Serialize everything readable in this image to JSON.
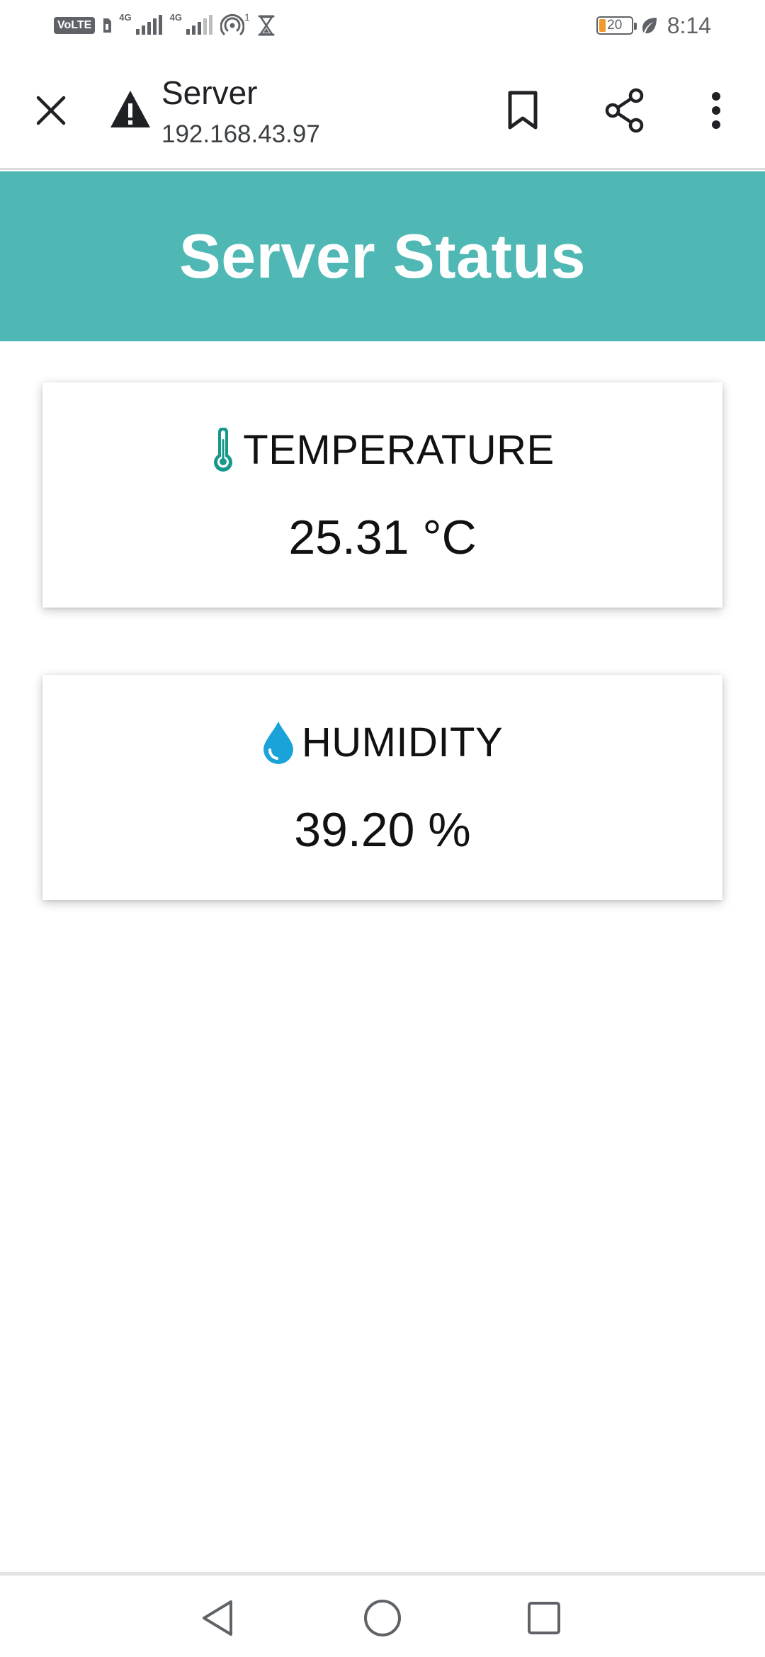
{
  "status_bar": {
    "volte_label": "VoLTE",
    "net1_label": "4G",
    "net2_label": "4G",
    "hotspot_count": "1",
    "battery_level": "20",
    "time": "8:14"
  },
  "toolbar": {
    "page_title": "Server",
    "url": "192.168.43.97",
    "icons": [
      "close-icon",
      "warning-icon",
      "bookmark-icon",
      "share-icon",
      "more-vert-icon"
    ]
  },
  "page": {
    "title": "Server Status",
    "header_color": "#50b8b4"
  },
  "cards": {
    "temperature": {
      "label": "TEMPERATURE",
      "value": "25.31 °C",
      "icon": "thermometer-icon",
      "icon_color": "#18988a"
    },
    "humidity": {
      "label": "HUMIDITY",
      "value": "39.20 %",
      "icon": "water-drop-icon",
      "icon_color": "#1aa3d9"
    }
  },
  "nav_bar": {
    "icons": [
      "back-icon",
      "home-icon",
      "recents-icon"
    ]
  }
}
